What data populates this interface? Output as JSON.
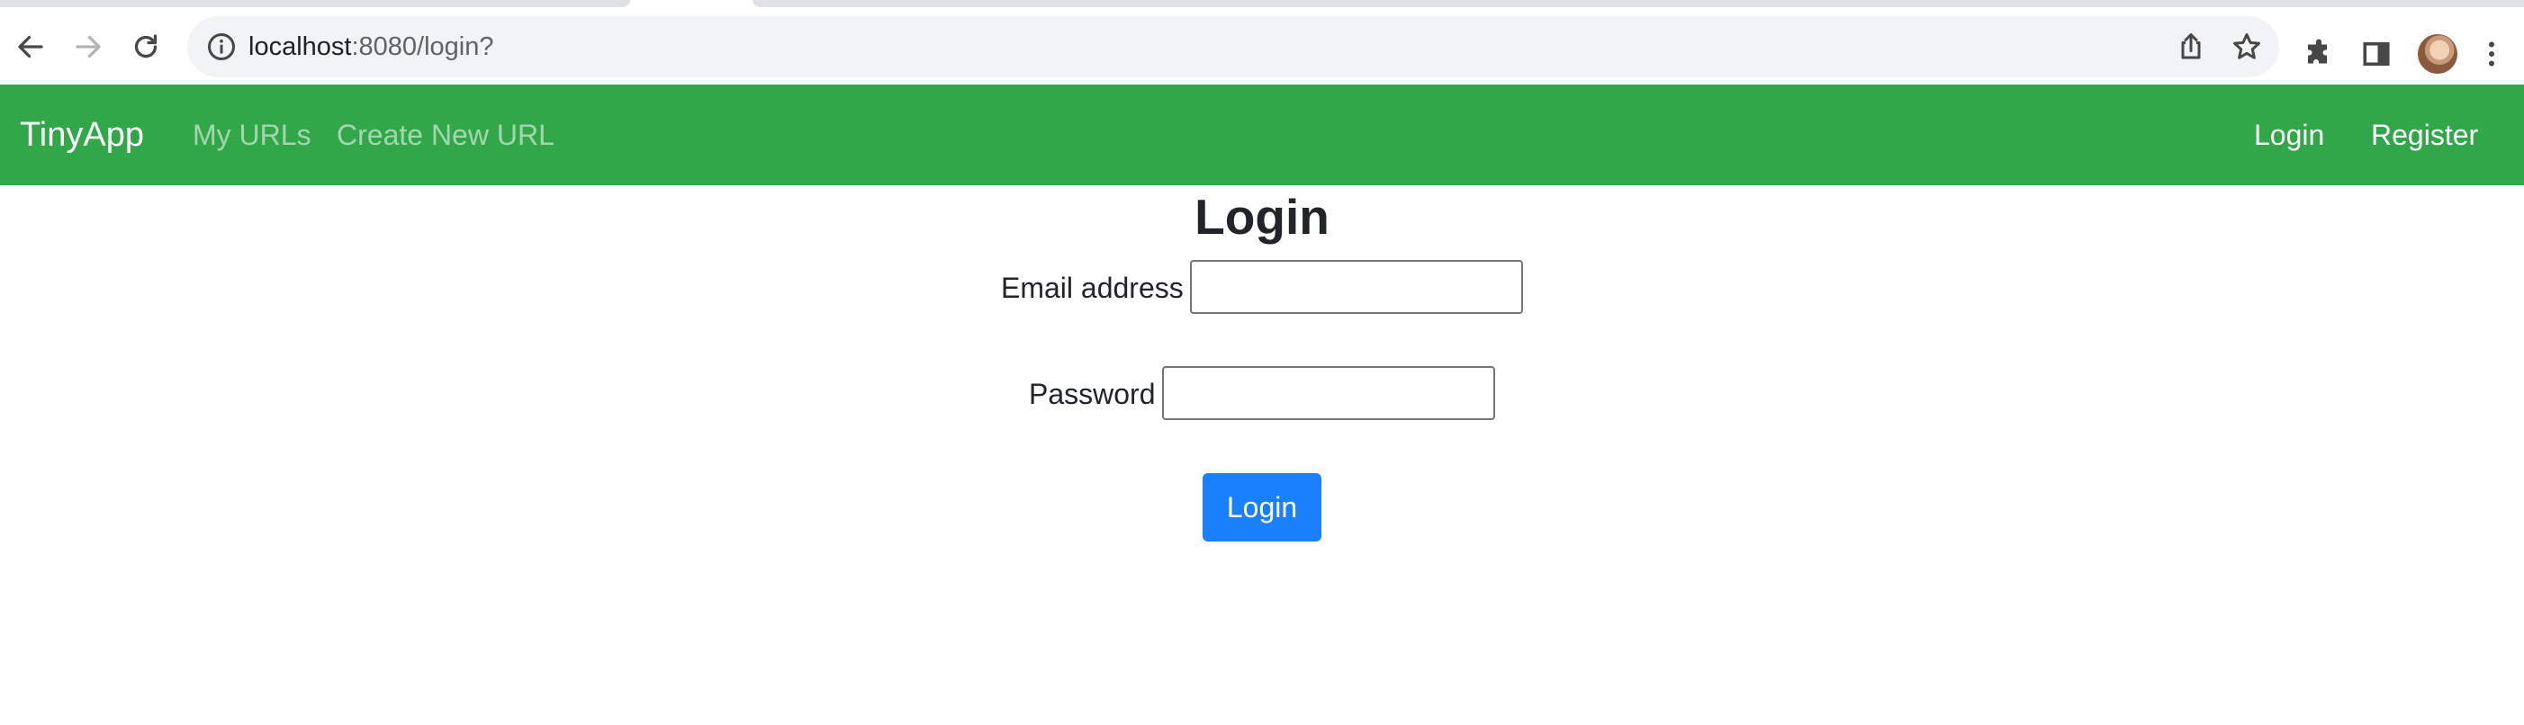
{
  "browser": {
    "url_host": "localhost",
    "url_rest": ":8080/login?",
    "icons": [
      "back-arrow-icon",
      "forward-arrow-icon",
      "reload-icon",
      "info-icon",
      "share-icon",
      "star-icon",
      "extensions-icon",
      "side-panel-icon",
      "kebab-menu-icon"
    ]
  },
  "navbar": {
    "brand": "TinyApp",
    "left_links": [
      "My URLs",
      "Create New URL"
    ],
    "right_links": [
      "Login",
      "Register"
    ],
    "background": "#31a74a"
  },
  "form": {
    "title": "Login",
    "email_label": "Email address",
    "email_value": "",
    "password_label": "Password",
    "password_value": "",
    "submit_label": "Login",
    "submit_color": "#1a7ffb"
  }
}
